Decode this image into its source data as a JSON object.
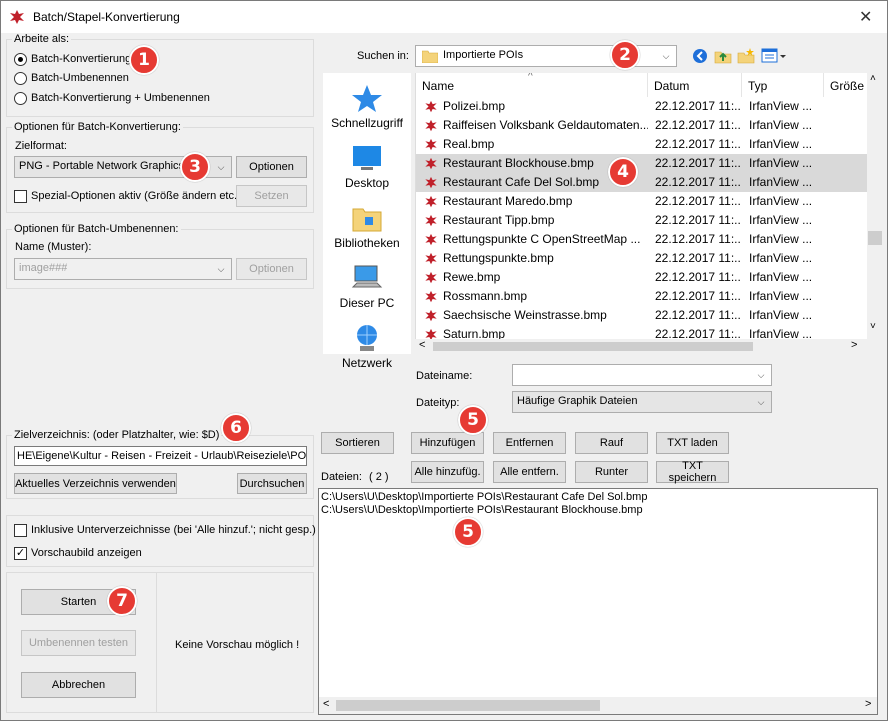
{
  "window": {
    "title": "Batch/Stapel-Konvertierung",
    "close": "✕"
  },
  "left": {
    "work_as_label": "Arbeite als:",
    "modes": [
      "Batch-Konvertierung",
      "Batch-Umbenennen",
      "Batch-Konvertierung + Umbenennen"
    ],
    "selected_mode": 0,
    "conv_group_label": "Optionen für Batch-Konvertierung:",
    "target_format_label": "Zielformat:",
    "target_format_value": "PNG - Portable Network Graphics",
    "options_button": "Optionen",
    "special_options_label": "Spezial-Optionen aktiv (Größe ändern etc.)",
    "special_options_checked": false,
    "set_button": "Setzen",
    "rename_group_label": "Optionen für Batch-Umbenennen:",
    "name_pattern_label": "Name (Muster):",
    "name_pattern_value": "image###",
    "rename_options_button": "Optionen",
    "target_dir_label": "Zielverzeichnis: (oder Platzhalter, wie: $D)",
    "target_dir_value": "HE\\Eigene\\Kultur - Reisen - Freizeit - Urlaub\\Reiseziele\\POI\\",
    "use_current_dir_button": "Aktuelles Verzeichnis verwenden",
    "browse_button": "Durchsuchen",
    "include_subdirs_label": "Inklusive Unterverzeichnisse (bei 'Alle hinzuf.'; nicht gesp.)",
    "include_subdirs_checked": false,
    "show_preview_label": "Vorschaubild anzeigen",
    "show_preview_checked": true,
    "start_button": "Starten",
    "test_rename_button": "Umbenennen testen",
    "cancel_button": "Abbrechen",
    "preview_text": "Keine Vorschau möglich !"
  },
  "browser": {
    "search_in_label": "Suchen in:",
    "folder": "Importierte POIs",
    "places": [
      "Schnellzugriff",
      "Desktop",
      "Bibliotheken",
      "Dieser PC",
      "Netzwerk"
    ],
    "columns": [
      "Name",
      "Datum",
      "Typ",
      "Größe"
    ],
    "files": [
      {
        "name": "Polizei.bmp",
        "date": "22.12.2017 11:...",
        "type": "IrfanView ...",
        "selected": false
      },
      {
        "name": "Raiffeisen Volksbank Geldautomaten...",
        "date": "22.12.2017 11:...",
        "type": "IrfanView ...",
        "selected": false
      },
      {
        "name": "Real.bmp",
        "date": "22.12.2017 11:...",
        "type": "IrfanView ...",
        "selected": false
      },
      {
        "name": "Restaurant Blockhouse.bmp",
        "date": "22.12.2017 11:...",
        "type": "IrfanView ...",
        "selected": true
      },
      {
        "name": "Restaurant Cafe Del Sol.bmp",
        "date": "22.12.2017 11:...",
        "type": "IrfanView ...",
        "selected": true
      },
      {
        "name": "Restaurant Maredo.bmp",
        "date": "22.12.2017 11:...",
        "type": "IrfanView ...",
        "selected": false
      },
      {
        "name": "Restaurant Tipp.bmp",
        "date": "22.12.2017 11:...",
        "type": "IrfanView ...",
        "selected": false
      },
      {
        "name": "Rettungspunkte C OpenStreetMap ...",
        "date": "22.12.2017 11:...",
        "type": "IrfanView ...",
        "selected": false
      },
      {
        "name": "Rettungspunkte.bmp",
        "date": "22.12.2017 11:...",
        "type": "IrfanView ...",
        "selected": false
      },
      {
        "name": "Rewe.bmp",
        "date": "22.12.2017 11:...",
        "type": "IrfanView ...",
        "selected": false
      },
      {
        "name": "Rossmann.bmp",
        "date": "22.12.2017 11:...",
        "type": "IrfanView ...",
        "selected": false
      },
      {
        "name": "Saechsische Weinstrasse.bmp",
        "date": "22.12.2017 11:...",
        "type": "IrfanView ...",
        "selected": false
      },
      {
        "name": "Saturn.bmp",
        "date": "22.12.2017 11:...",
        "type": "IrfanView ...",
        "selected": false
      }
    ],
    "filename_label": "Dateiname:",
    "filename_value": "",
    "filetype_label": "Dateityp:",
    "filetype_value": "Häufige Graphik Dateien"
  },
  "actions": {
    "sort": "Sortieren",
    "add": "Hinzufügen",
    "remove": "Entfernen",
    "up": "Rauf",
    "load_txt": "TXT laden",
    "add_all": "Alle hinzufüg.",
    "remove_all": "Alle entfern.",
    "down": "Runter",
    "save_txt": "TXT speichern"
  },
  "files_list": {
    "label": "Dateien:",
    "count": "( 2 )",
    "items": [
      "C:\\Users\\U\\Desktop\\Importierte POIs\\Restaurant Cafe Del Sol.bmp",
      "C:\\Users\\U\\Desktop\\Importierte POIs\\Restaurant Blockhouse.bmp"
    ]
  },
  "badges": [
    "1",
    "2",
    "3",
    "4",
    "5",
    "5",
    "6",
    "7"
  ],
  "colors": {
    "badge": "#e63a33",
    "selection": "#d9d9d9",
    "accent": "#1e6fd9"
  }
}
